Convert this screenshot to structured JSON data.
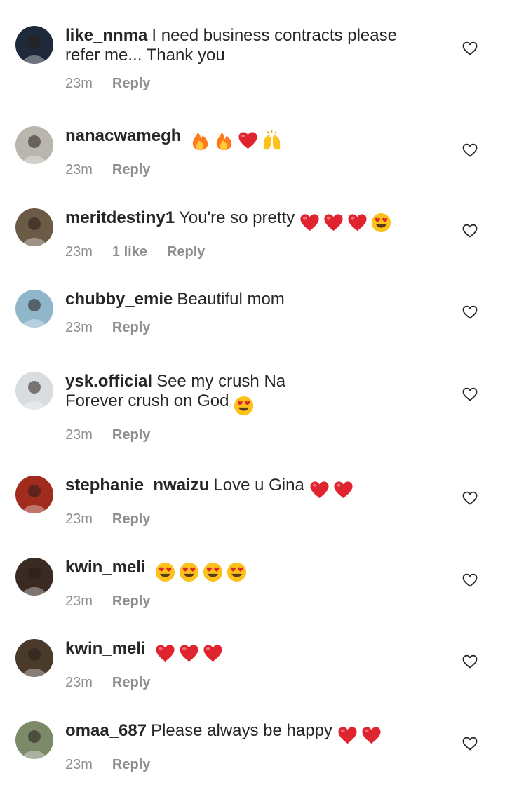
{
  "comments": [
    {
      "username": "like_nnma",
      "text": "I need business contracts please",
      "text2": "refer me... Thank you",
      "time": "23m",
      "likes": "",
      "reply": "Reply",
      "emojis": [],
      "avatar_color": "#1e2a3a"
    },
    {
      "username": "nanacwamegh",
      "text": "",
      "text2": "",
      "time": "23m",
      "likes": "",
      "reply": "Reply",
      "emojis": [
        "fire",
        "fire",
        "heart",
        "raised-hands"
      ],
      "avatar_color": "#b9b6ad"
    },
    {
      "username": "meritdestiny1",
      "text": "You're so pretty",
      "text2": "",
      "time": "23m",
      "likes": "1 like",
      "reply": "Reply",
      "emojis": [
        "heart",
        "heart",
        "heart",
        "heart-eyes"
      ],
      "avatar_color": "#6b5a45"
    },
    {
      "username": "chubby_emie",
      "text": "Beautiful mom",
      "text2": "",
      "time": "23m",
      "likes": "",
      "reply": "Reply",
      "emojis": [],
      "avatar_color": "#8fb6c9"
    },
    {
      "username": "ysk.official",
      "text": "See my crush Na",
      "text2": "Forever crush on God",
      "time": "23m",
      "likes": "",
      "reply": "Reply",
      "emojis": [],
      "emojis2": [
        "heart-eyes"
      ],
      "avatar_color": "#d9dde0"
    },
    {
      "username": "stephanie_nwaizu",
      "text": "Love u Gina",
      "text2": "",
      "time": "23m",
      "likes": "",
      "reply": "Reply",
      "emojis": [
        "heart",
        "heart"
      ],
      "avatar_color": "#a12b1c"
    },
    {
      "username": "kwin_meli",
      "text": "",
      "text2": "",
      "time": "23m",
      "likes": "",
      "reply": "Reply",
      "emojis": [
        "heart-eyes",
        "heart-eyes",
        "heart-eyes",
        "heart-eyes"
      ],
      "avatar_color": "#3b2a22"
    },
    {
      "username": "kwin_meli",
      "text": "",
      "text2": "",
      "time": "23m",
      "likes": "",
      "reply": "Reply",
      "emojis": [
        "heart",
        "heart",
        "heart"
      ],
      "avatar_color": "#4a3a2c"
    },
    {
      "username": "omaa_687",
      "text": "Please always be happy",
      "text2": "",
      "time": "23m",
      "likes": "",
      "reply": "Reply",
      "emojis": [
        "heart",
        "heart"
      ],
      "avatar_color": "#7c8a6a"
    }
  ],
  "colors": {
    "heart": "#e0242f",
    "meta": "#8e8e8e",
    "text": "#262626"
  }
}
